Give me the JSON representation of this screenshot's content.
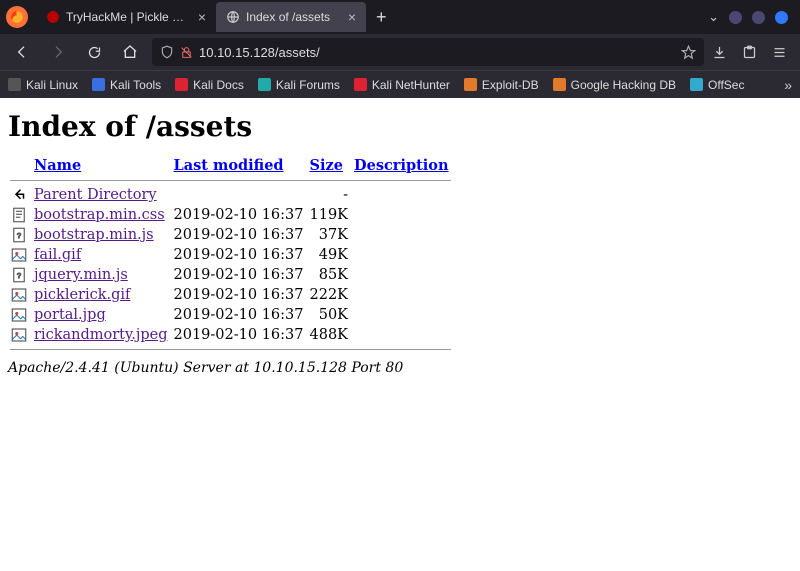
{
  "tabs": [
    {
      "title": "TryHackMe | Pickle Rick",
      "active": false
    },
    {
      "title": "Index of /assets",
      "active": true
    }
  ],
  "url": "10.10.15.128/assets/",
  "bookmarks": [
    {
      "label": "Kali Linux",
      "color": "#555"
    },
    {
      "label": "Kali Tools",
      "color": "#3a6fe0"
    },
    {
      "label": "Kali Docs",
      "color": "#d23"
    },
    {
      "label": "Kali Forums",
      "color": "#2aa"
    },
    {
      "label": "Kali NetHunter",
      "color": "#d23"
    },
    {
      "label": "Exploit-DB",
      "color": "#e27a2d"
    },
    {
      "label": "Google Hacking DB",
      "color": "#e27a2d"
    },
    {
      "label": "OffSec",
      "color": "#3ac"
    }
  ],
  "page": {
    "heading": "Index of /assets",
    "columns": {
      "name": "Name",
      "modified": "Last modified",
      "size": "Size",
      "desc": "Description"
    },
    "parent": {
      "label": "Parent Directory",
      "size": "-"
    },
    "files": [
      {
        "name": "bootstrap.min.css",
        "modified": "2019-02-10 16:37",
        "size": "119K",
        "type": "text"
      },
      {
        "name": "bootstrap.min.js",
        "modified": "2019-02-10 16:37",
        "size": "37K",
        "type": "unknown"
      },
      {
        "name": "fail.gif",
        "modified": "2019-02-10 16:37",
        "size": "49K",
        "type": "image"
      },
      {
        "name": "jquery.min.js",
        "modified": "2019-02-10 16:37",
        "size": "85K",
        "type": "unknown"
      },
      {
        "name": "picklerick.gif",
        "modified": "2019-02-10 16:37",
        "size": "222K",
        "type": "image"
      },
      {
        "name": "portal.jpg",
        "modified": "2019-02-10 16:37",
        "size": "50K",
        "type": "image"
      },
      {
        "name": "rickandmorty.jpeg",
        "modified": "2019-02-10 16:37",
        "size": "488K",
        "type": "image"
      }
    ],
    "server": "Apache/2.4.41 (Ubuntu) Server at 10.10.15.128 Port 80"
  }
}
